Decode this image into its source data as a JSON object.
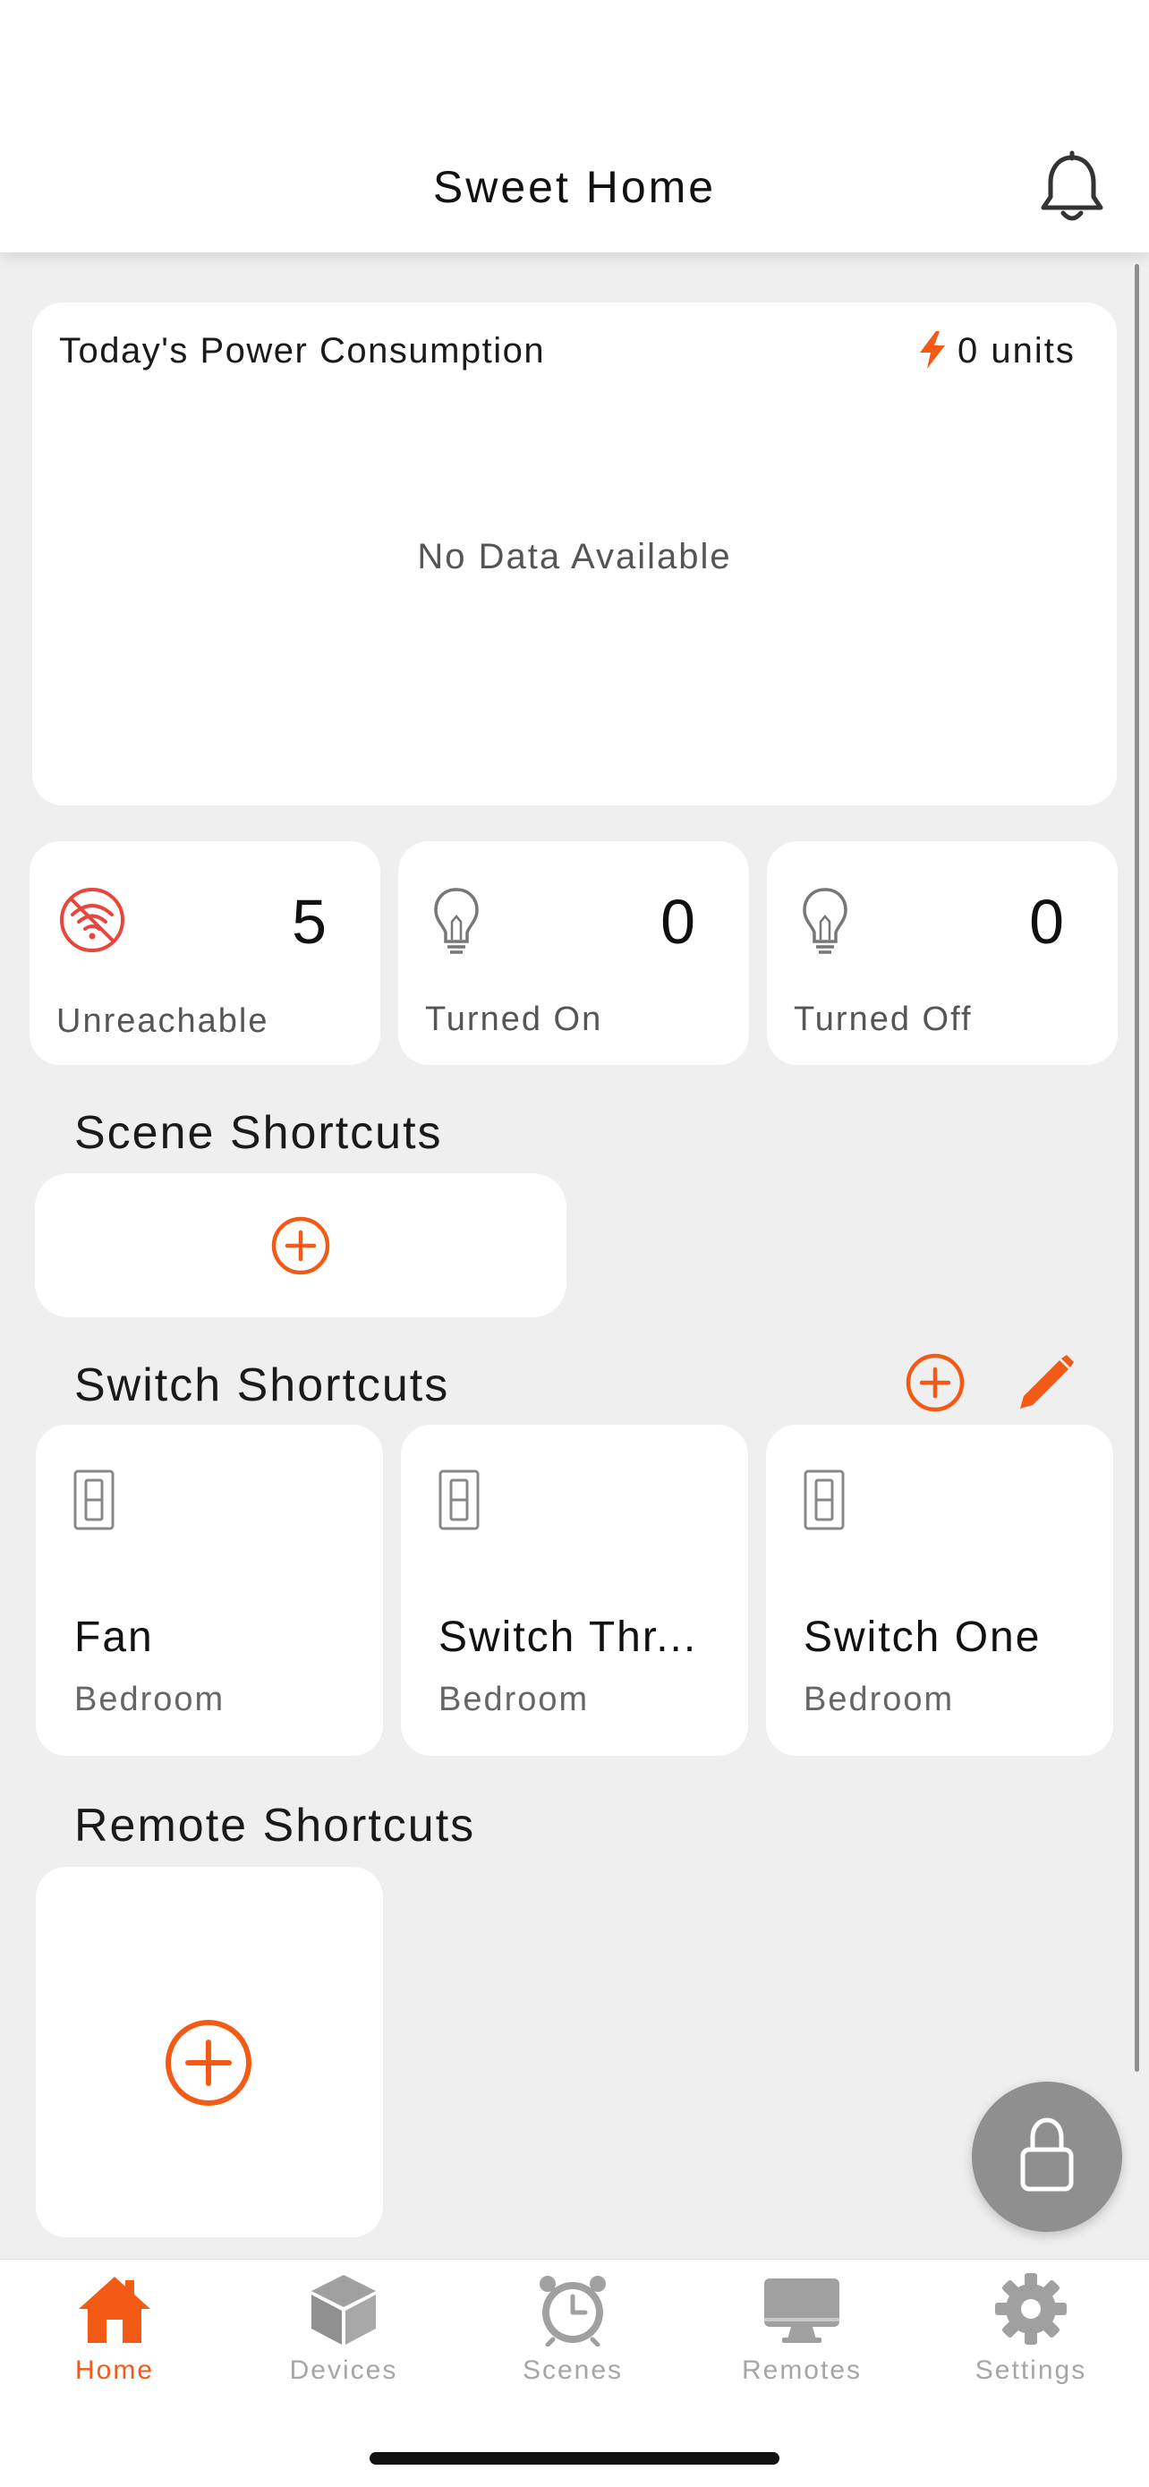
{
  "header": {
    "title": "Sweet Home"
  },
  "power": {
    "title": "Today's Power Consumption",
    "units": "0 units",
    "empty_text": "No Data Available"
  },
  "stats": [
    {
      "value": "5",
      "label": "Unreachable",
      "icon": "wifi-off-icon"
    },
    {
      "value": "0",
      "label": "Turned On",
      "icon": "bulb-icon"
    },
    {
      "value": "0",
      "label": "Turned Off",
      "icon": "bulb-icon"
    }
  ],
  "sections": {
    "scene": "Scene Shortcuts",
    "switch": "Switch Shortcuts",
    "remote": "Remote Shortcuts"
  },
  "switches": [
    {
      "name": "Fan",
      "room": "Bedroom"
    },
    {
      "name": "Switch Thr...",
      "room": "Bedroom"
    },
    {
      "name": "Switch One",
      "room": "Bedroom"
    }
  ],
  "nav": [
    {
      "label": "Home",
      "icon": "home-icon",
      "active": true
    },
    {
      "label": "Devices",
      "icon": "cube-icon",
      "active": false
    },
    {
      "label": "Scenes",
      "icon": "clock-icon",
      "active": false
    },
    {
      "label": "Remotes",
      "icon": "monitor-icon",
      "active": false
    },
    {
      "label": "Settings",
      "icon": "gear-icon",
      "active": false
    }
  ],
  "colors": {
    "accent": "#f25a16",
    "background": "#efefef",
    "card": "#ffffff",
    "alert": "#e8463c",
    "fab": "#8f8f8f"
  }
}
